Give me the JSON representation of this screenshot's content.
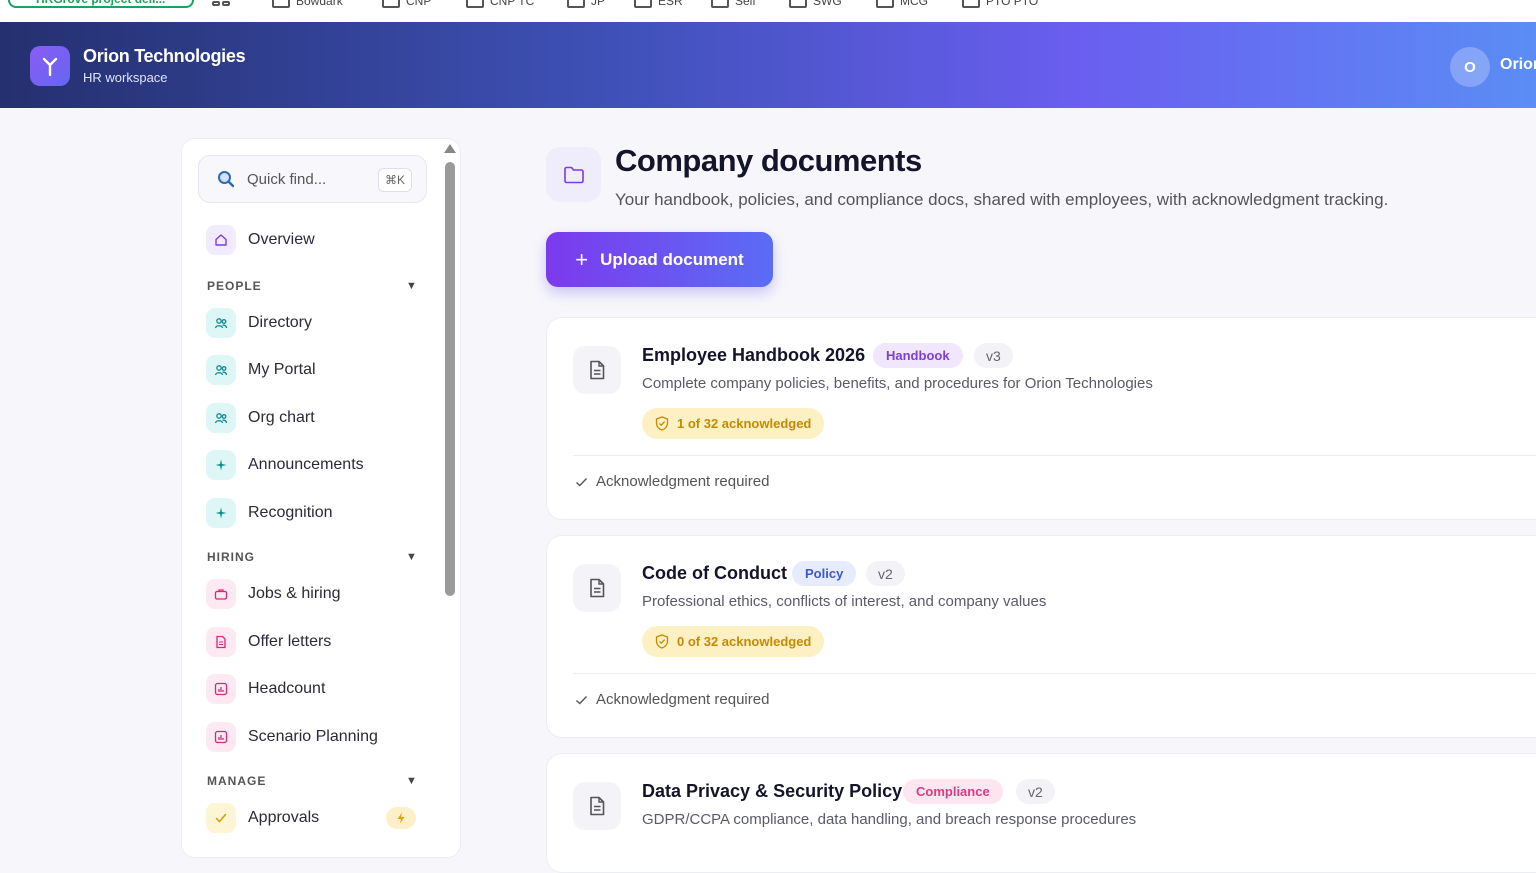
{
  "bookmarks": {
    "first_pill": "HRGrove project deli...",
    "folders": [
      "Bowdark",
      "CNP",
      "CNP TC",
      "JP",
      "ESR",
      "Self",
      "SWG",
      "MCG",
      "PTO PTO"
    ]
  },
  "header": {
    "brand_name": "Orion Technologies",
    "brand_sub": "HR workspace",
    "avatar_initial": "O",
    "user_name": "Orion"
  },
  "sidebar": {
    "search_placeholder": "Quick find...",
    "search_shortcut": "⌘K",
    "overview": "Overview",
    "sections": {
      "people": "PEOPLE",
      "hiring": "HIRING",
      "manage": "MANAGE"
    },
    "people_items": [
      "Directory",
      "My Portal",
      "Org chart",
      "Announcements",
      "Recognition"
    ],
    "hiring_items": [
      "Jobs & hiring",
      "Offer letters",
      "Headcount",
      "Scenario Planning"
    ],
    "manage_items": [
      "Approvals"
    ]
  },
  "main": {
    "title": "Company documents",
    "subtitle": "Your handbook, policies, and compliance docs, shared with employees, with acknowledgment tracking.",
    "upload_label": "Upload document",
    "documents": [
      {
        "title": "Employee Handbook 2026",
        "tag": "Handbook",
        "version": "v3",
        "description": "Complete company policies, benefits, and procedures for Orion Technologies",
        "ack": "1 of 32 acknowledged",
        "footer": "Acknowledgment required"
      },
      {
        "title": "Code of Conduct",
        "tag": "Policy",
        "version": "v2",
        "description": "Professional ethics, conflicts of interest, and company values",
        "ack": "0 of 32 acknowledged",
        "footer": "Acknowledgment required"
      },
      {
        "title": "Data Privacy & Security Policy",
        "tag": "Compliance",
        "version": "v2",
        "description": "GDPR/CCPA compliance, data handling, and breach response procedures"
      }
    ]
  },
  "colors": {
    "accent": "#7c3aed",
    "handbook_tag": "#f0e6fd",
    "policy_tag": "#e6ebfd",
    "compliance_tag": "#fde6f0",
    "ack_pill": "#fdf0c2"
  }
}
